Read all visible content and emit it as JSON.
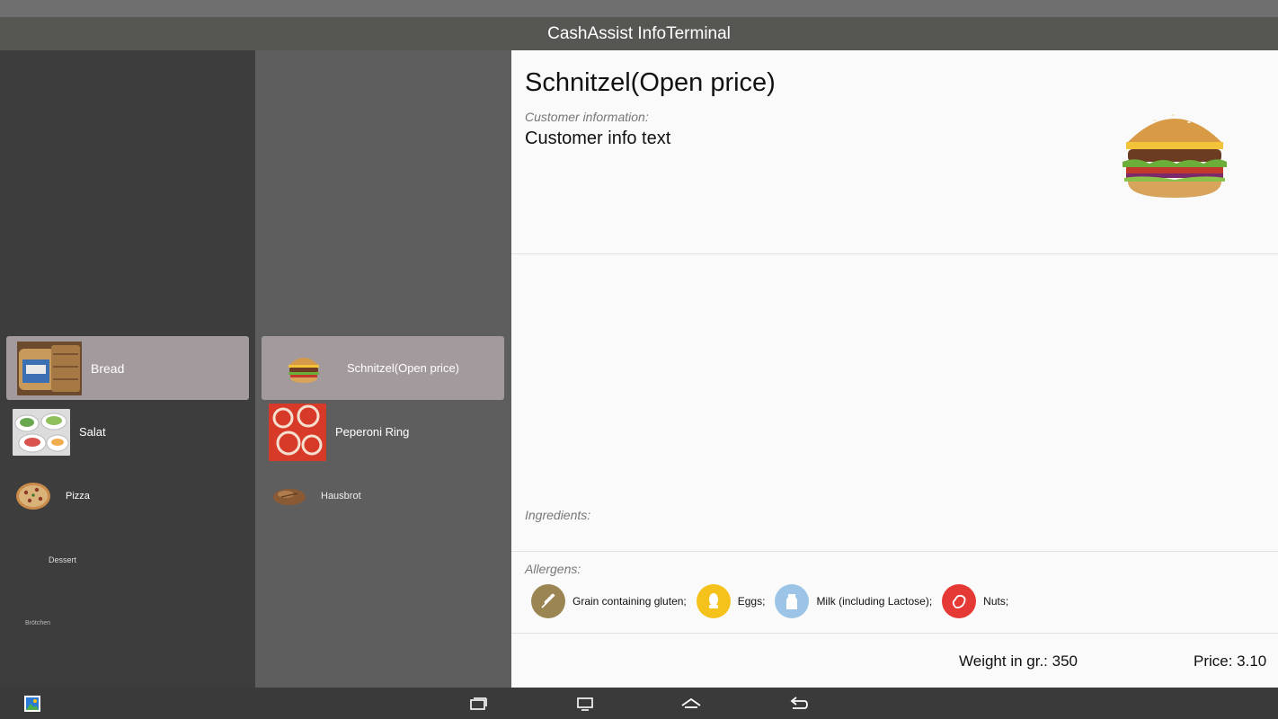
{
  "app": {
    "title": "CashAssist InfoTerminal"
  },
  "categories": [
    {
      "label": "Bread",
      "selected": true,
      "icon": "bread-photo"
    },
    {
      "label": "Salat",
      "selected": false,
      "icon": "salad-photo"
    },
    {
      "label": "Pizza",
      "selected": false,
      "icon": "pizza-photo"
    },
    {
      "label": "Dessert",
      "selected": false,
      "icon": ""
    },
    {
      "label": "Brötchen",
      "selected": false,
      "icon": ""
    }
  ],
  "items": [
    {
      "label": "Schnitzel(Open price)",
      "selected": true,
      "icon": "burger-photo"
    },
    {
      "label": "Peperoni Ring",
      "selected": false,
      "icon": "peperoni-photo"
    },
    {
      "label": "Hausbrot",
      "selected": false,
      "icon": "bread-loaf-photo"
    }
  ],
  "detail": {
    "title": "Schnitzel(Open price)",
    "customer_label": "Customer information:",
    "customer_text": "Customer info text",
    "ingredients_label": "Ingredients:",
    "allergens_label": "Allergens:",
    "allergens": [
      {
        "name": "Grain containing gluten;",
        "icon": "wheat-icon",
        "color": "#9b8553"
      },
      {
        "name": "Eggs;",
        "icon": "egg-icon",
        "color": "#f5c21b"
      },
      {
        "name": "Milk (including Lactose);",
        "icon": "milk-icon",
        "color": "#9cc4e6"
      },
      {
        "name": "Nuts;",
        "icon": "nut-icon",
        "color": "#e53935"
      }
    ],
    "weight": "Weight in gr.: 350",
    "price": "Price: 3.10"
  },
  "colors": {
    "selected_bg": "#a29a9c",
    "titlebar": "#565653"
  }
}
